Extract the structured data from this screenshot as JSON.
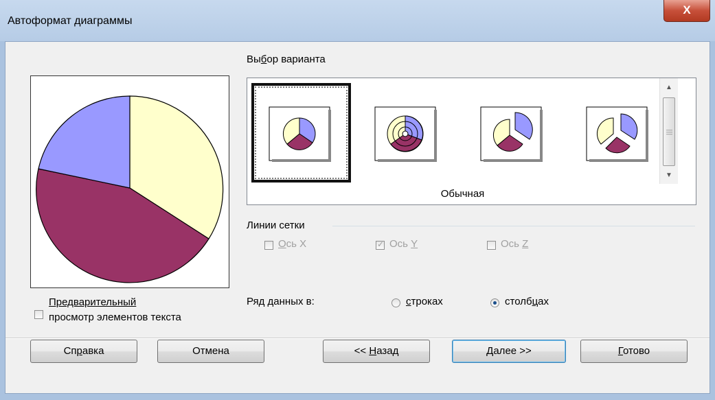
{
  "window": {
    "title": "Автоформат диаграммы",
    "close_label": "X"
  },
  "preview": {
    "checkbox_label_line1": "Предварительный",
    "checkbox_label_line2": "просмотр элементов текста",
    "checked": false,
    "slice_colors": [
      "#ffffcc",
      "#993366",
      "#9999ff"
    ]
  },
  "variants": {
    "section_title_pre": "Вы",
    "section_title_ul": "б",
    "section_title_post": "ор варианта",
    "selected_caption": "Обычная",
    "items": [
      "pie-normal",
      "pie-ring",
      "pie-exploded-one",
      "pie-exploded-all"
    ]
  },
  "grid": {
    "title": "Линии сетки",
    "axis_x": {
      "pre": "",
      "ul": "О",
      "post": "сь X",
      "checked": false
    },
    "axis_y": {
      "pre": "Ось ",
      "ul": "Y",
      "post": "",
      "checked": true
    },
    "axis_z": {
      "pre": "Ось ",
      "ul": "Z",
      "post": "",
      "checked": false
    }
  },
  "series": {
    "label": "Ряд данных в:",
    "rows": {
      "pre": "",
      "ul": "с",
      "post": "троках",
      "selected": false
    },
    "cols": {
      "pre": "столб",
      "ul": "ц",
      "post": "ах",
      "selected": true
    }
  },
  "buttons": {
    "help": {
      "pre": "Сп",
      "ul": "р",
      "post": "авка"
    },
    "cancel": "Отмена",
    "back": {
      "pre": "<< ",
      "ul": "Н",
      "post": "азад"
    },
    "next": {
      "pre": "",
      "ul": "Д",
      "post": "алее >>"
    },
    "finish": {
      "pre": "",
      "ul": "Г",
      "post": "отово"
    }
  }
}
